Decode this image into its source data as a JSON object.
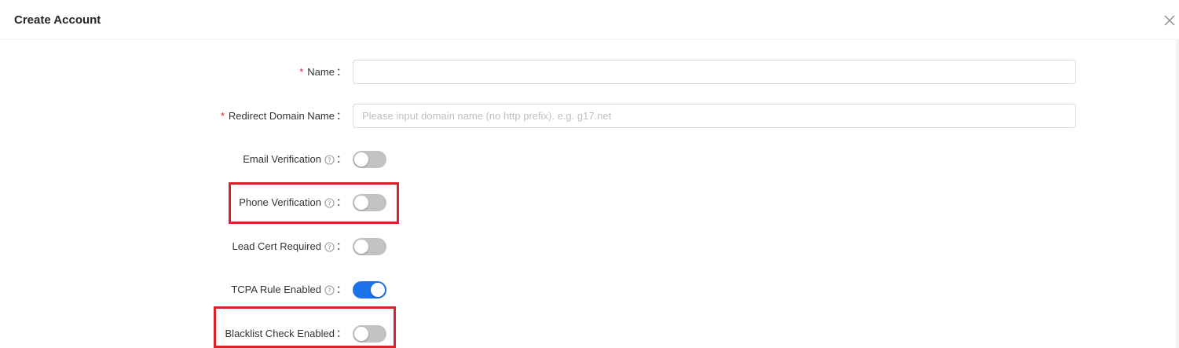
{
  "modal": {
    "title": "Create Account",
    "close_icon": "close-icon"
  },
  "colors": {
    "required": "#e0202a",
    "switch_on": "#1a73e8",
    "switch_off": "#c2c2c2",
    "highlight": "#d9232b"
  },
  "form": {
    "name": {
      "label": "Name",
      "required": true,
      "value": "",
      "placeholder": ""
    },
    "redirect_domain": {
      "label": "Redirect Domain Name",
      "required": true,
      "value": "",
      "placeholder": "Please input domain name (no http prefix). e.g. g17.net"
    },
    "email_verification": {
      "label": "Email Verification",
      "enabled": false,
      "help_icon": "question-circle-icon"
    },
    "phone_verification": {
      "label": "Phone Verification",
      "enabled": false,
      "help_icon": "question-circle-icon"
    },
    "lead_cert_required": {
      "label": "Lead Cert Required",
      "enabled": false,
      "help_icon": "question-circle-icon"
    },
    "tcpa_rule_enabled": {
      "label": "TCPA Rule Enabled",
      "enabled": true,
      "help_icon": "question-circle-icon"
    },
    "blacklist_check_enabled": {
      "label": "Blacklist Check Enabled",
      "enabled": false
    }
  },
  "colon": "：",
  "asterisk": "*"
}
